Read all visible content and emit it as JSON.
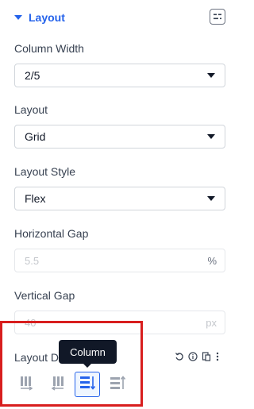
{
  "section": {
    "title": "Layout",
    "responsive_icon": "responsive-icon"
  },
  "fields": {
    "column_width": {
      "label": "Column Width",
      "value": "2/5"
    },
    "layout": {
      "label": "Layout",
      "value": "Grid"
    },
    "layout_style": {
      "label": "Layout Style",
      "value": "Flex"
    },
    "horizontal_gap": {
      "label": "Horizontal Gap",
      "placeholder": "5.5",
      "unit": "%"
    },
    "vertical_gap": {
      "label": "Vertical Gap",
      "placeholder": "40",
      "unit": "px"
    },
    "layout_direction": {
      "label": "Layout D",
      "tooltip": "Column",
      "options": [
        {
          "name": "row",
          "icon": "row-icon",
          "active": false
        },
        {
          "name": "row-reverse",
          "icon": "row-reverse-icon",
          "active": false
        },
        {
          "name": "column",
          "icon": "column-icon",
          "active": true
        },
        {
          "name": "column-reverse",
          "icon": "column-reverse-icon",
          "active": false
        }
      ]
    }
  },
  "actions": [
    "reset-icon",
    "info-icon",
    "copy-icon",
    "more-icon"
  ],
  "colors": {
    "accent": "#2563eb",
    "highlight": "#d81e1e",
    "tooltip_bg": "#111827"
  }
}
